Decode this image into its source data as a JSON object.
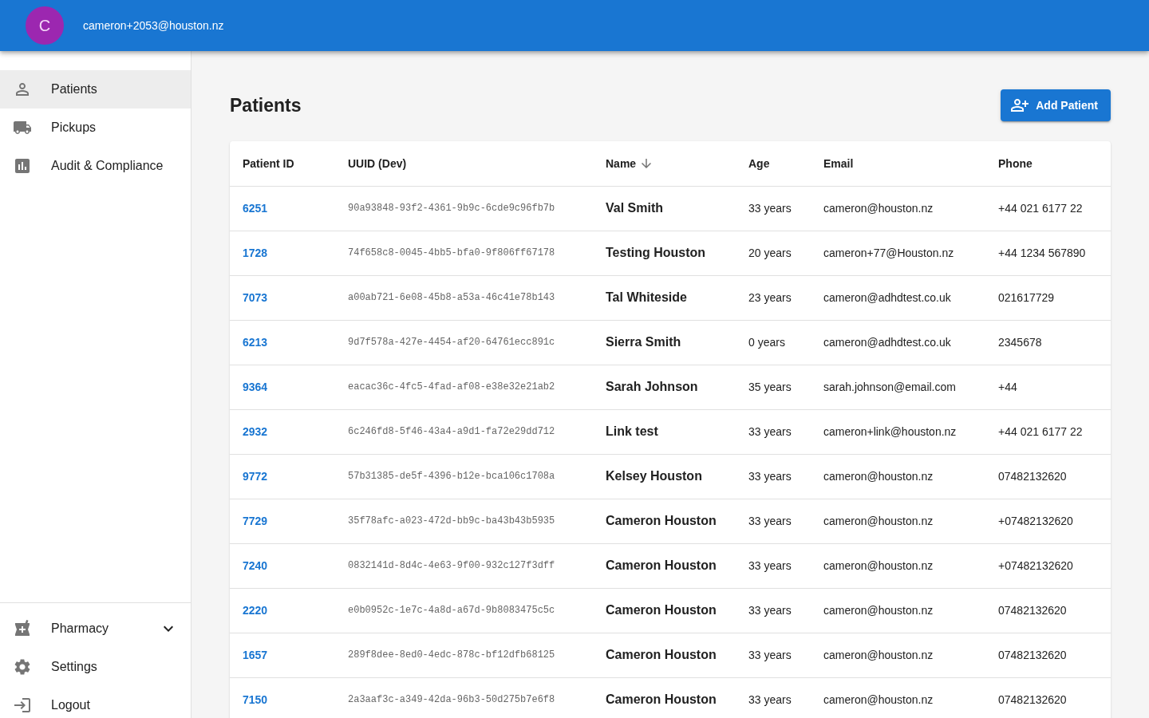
{
  "header": {
    "avatar_initial": "C",
    "email": "cameron+2053@houston.nz"
  },
  "sidebar": {
    "items": [
      {
        "label": "Patients",
        "kind": "link",
        "selected": true
      },
      {
        "label": "Pickups",
        "kind": "link",
        "selected": false
      },
      {
        "label": "Audit & Compliance",
        "kind": "link",
        "selected": false
      }
    ],
    "bottom_items": [
      {
        "label": "Pharmacy",
        "kind": "group",
        "expanded": false,
        "selected": false
      },
      {
        "label": "Settings",
        "kind": "link",
        "selected": false
      },
      {
        "label": "Logout",
        "kind": "link",
        "selected": false
      }
    ]
  },
  "page": {
    "title": "Patients",
    "add_button": "Add Patient"
  },
  "table": {
    "sort_descending": true,
    "columns": [
      {
        "label": "Patient ID",
        "sorted": false
      },
      {
        "label": "UUID (Dev)",
        "sorted": false
      },
      {
        "label": "Name",
        "sorted": true
      },
      {
        "label": "Age",
        "sorted": false
      },
      {
        "label": "Email",
        "sorted": false
      },
      {
        "label": "Phone",
        "sorted": false
      }
    ],
    "rows": [
      {
        "patient_id": "6251",
        "uuid": "90a93848-93f2-4361-9b9c-6cde9c96fb7b",
        "name": "Val Smith",
        "age": "33 years",
        "email": "cameron@houston.nz",
        "phone": "+44 021 6177 22"
      },
      {
        "patient_id": "1728",
        "uuid": "74f658c8-0045-4bb5-bfa0-9f806ff67178",
        "name": "Testing Houston",
        "age": "20 years",
        "email": "cameron+77@Houston.nz",
        "phone": "+44 1234 567890"
      },
      {
        "patient_id": "7073",
        "uuid": "a00ab721-6e08-45b8-a53a-46c41e78b143",
        "name": "Tal Whiteside",
        "age": "23 years",
        "email": "cameron@adhdtest.co.uk",
        "phone": "021617729"
      },
      {
        "patient_id": "6213",
        "uuid": "9d7f578a-427e-4454-af20-64761ecc891c",
        "name": "Sierra Smith",
        "age": "0 years",
        "email": "cameron@adhdtest.co.uk",
        "phone": "2345678"
      },
      {
        "patient_id": "9364",
        "uuid": "eacac36c-4fc5-4fad-af08-e38e32e21ab2",
        "name": "Sarah Johnson",
        "age": "35 years",
        "email": "sarah.johnson@email.com",
        "phone": "+44"
      },
      {
        "patient_id": "2932",
        "uuid": "6c246fd8-5f46-43a4-a9d1-fa72e29dd712",
        "name": "Link test",
        "age": "33 years",
        "email": "cameron+link@houston.nz",
        "phone": "+44 021 6177 22"
      },
      {
        "patient_id": "9772",
        "uuid": "57b31385-de5f-4396-b12e-bca106c1708a",
        "name": "Kelsey Houston",
        "age": "33 years",
        "email": "cameron@houston.nz",
        "phone": "07482132620"
      },
      {
        "patient_id": "7729",
        "uuid": "35f78afc-a023-472d-bb9c-ba43b43b5935",
        "name": "Cameron Houston",
        "age": "33 years",
        "email": "cameron@houston.nz",
        "phone": "+07482132620"
      },
      {
        "patient_id": "7240",
        "uuid": "0832141d-8d4c-4e63-9f00-932c127f3dff",
        "name": "Cameron Houston",
        "age": "33 years",
        "email": "cameron@houston.nz",
        "phone": "+07482132620"
      },
      {
        "patient_id": "2220",
        "uuid": "e0b0952c-1e7c-4a8d-a67d-9b8083475c5c",
        "name": "Cameron Houston",
        "age": "33 years",
        "email": "cameron@houston.nz",
        "phone": "07482132620"
      },
      {
        "patient_id": "1657",
        "uuid": "289f8dee-8ed0-4edc-878c-bf12dfb68125",
        "name": "Cameron Houston",
        "age": "33 years",
        "email": "cameron@houston.nz",
        "phone": "07482132620"
      },
      {
        "patient_id": "7150",
        "uuid": "2a3aaf3c-a349-42da-96b3-50d275b7e6f8",
        "name": "Cameron Houston",
        "age": "33 years",
        "email": "cameron@houston.nz",
        "phone": "07482132620"
      }
    ]
  }
}
